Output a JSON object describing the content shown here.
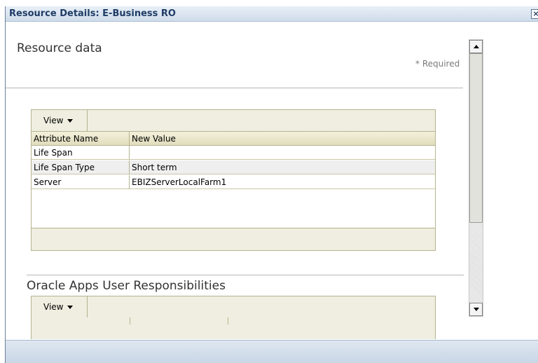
{
  "dialog": {
    "title": "Resource Details: E-Business RO",
    "close_icon": "close-icon"
  },
  "resource_section": {
    "title": "Resource data",
    "required_note": "* Required",
    "view_label": "View",
    "headers": [
      "Attribute Name",
      "New Value"
    ],
    "rows": [
      {
        "name": "Life Span",
        "value": ""
      },
      {
        "name": "Life Span Type",
        "value": "Short term"
      },
      {
        "name": "Server",
        "value": "EBIZServerLocalFarm1"
      }
    ]
  },
  "responsibilities_section": {
    "title": "Oracle Apps User Responsibilities",
    "view_label": "View"
  },
  "icons": {
    "view_dropdown": "chevron-down-icon",
    "scroll_up": "arrow-up-icon",
    "scroll_down": "arrow-down-icon"
  }
}
